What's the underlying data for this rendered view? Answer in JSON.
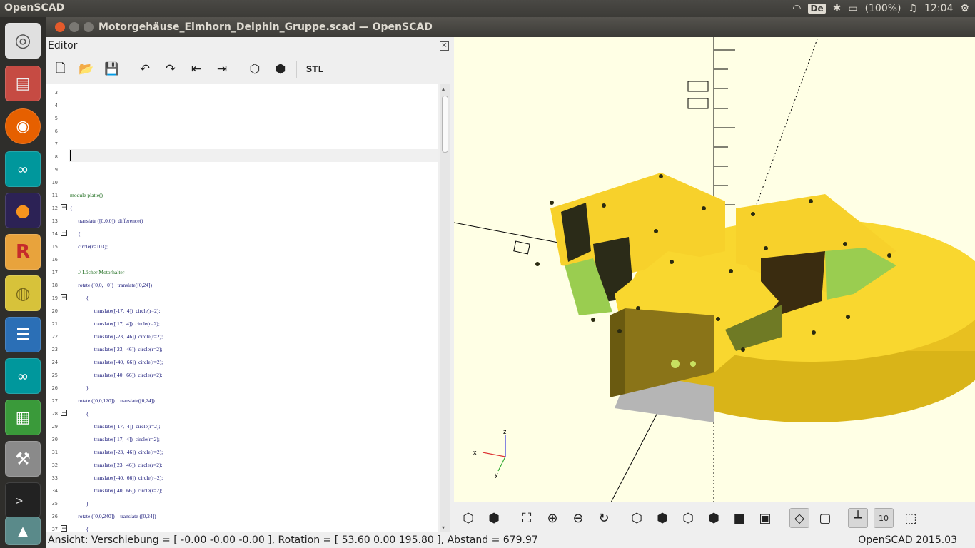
{
  "topbar": {
    "app_name": "OpenSCAD",
    "keyboard": "De",
    "battery": "(100%)",
    "clock": "12:04"
  },
  "window": {
    "title": "Motorgehäuse_Eimhorn_Delphin_Gruppe.scad — OpenSCAD"
  },
  "editor": {
    "title": "Editor",
    "toolbar": {
      "stl_label": "STL"
    },
    "lines": [
      {
        "n": "3",
        "t": ""
      },
      {
        "n": "4",
        "t": ""
      },
      {
        "n": "5",
        "t": ""
      },
      {
        "n": "6",
        "t": ""
      },
      {
        "n": "7",
        "t": ""
      },
      {
        "n": "8",
        "t": ""
      },
      {
        "n": "9",
        "t": ""
      },
      {
        "n": "10",
        "t": ""
      },
      {
        "n": "11",
        "t": "module platte()"
      },
      {
        "n": "12",
        "t": "{",
        "fold": "−"
      },
      {
        "n": "13",
        "t": "      translate ([0,0,0])  difference()"
      },
      {
        "n": "14",
        "t": "      {",
        "fold": "−"
      },
      {
        "n": "15",
        "t": "      circle(r=103);"
      },
      {
        "n": "16",
        "t": ""
      },
      {
        "n": "17",
        "t": "      // Löcher Motorhalter"
      },
      {
        "n": "18",
        "t": "      rotate ([0,0,   0])   translate([0,24])"
      },
      {
        "n": "19",
        "t": "            {",
        "fold": "−"
      },
      {
        "n": "20",
        "t": "                  translate([-17,  4])  circle(r=2);"
      },
      {
        "n": "21",
        "t": "                  translate([ 17,  4])  circle(r=2);"
      },
      {
        "n": "22",
        "t": "                  translate([-23,  46])  circle(r=2);"
      },
      {
        "n": "23",
        "t": "                  translate([ 23,  46])  circle(r=2);"
      },
      {
        "n": "24",
        "t": "                  translate([-40,  66])  circle(r=2);"
      },
      {
        "n": "25",
        "t": "                  translate([ 40,  66])  circle(r=2);"
      },
      {
        "n": "26",
        "t": "            }"
      },
      {
        "n": "27",
        "t": "      rotate ([0,0,120])    translate([0,24])"
      },
      {
        "n": "28",
        "t": "            {",
        "fold": "−"
      },
      {
        "n": "29",
        "t": "                  translate([-17,  4])  circle(r=2);"
      },
      {
        "n": "30",
        "t": "                  translate([ 17,  4])  circle(r=2);"
      },
      {
        "n": "31",
        "t": "                  translate([-23,  46])  circle(r=2);"
      },
      {
        "n": "32",
        "t": "                  translate([ 23,  46])  circle(r=2);"
      },
      {
        "n": "33",
        "t": "                  translate([-40,  66])  circle(r=2);"
      },
      {
        "n": "34",
        "t": "                  translate([ 40,  66])  circle(r=2);"
      },
      {
        "n": "35",
        "t": "            }"
      },
      {
        "n": "36",
        "t": "      rotate ([0,0,240])    translate ([0,24])"
      },
      {
        "n": "37",
        "t": "            {",
        "fold": "−"
      }
    ]
  },
  "viewport": {
    "axis_labels": {
      "x": "x",
      "y": "y",
      "z": "z"
    },
    "zoom_badge": "10"
  },
  "status": {
    "left": "Ansicht: Verschiebung = [ -0.00 -0.00 -0.00 ], Rotation = [ 53.60 0.00 195.80 ], Abstand = 679.97",
    "right": "OpenSCAD 2015.03"
  },
  "colors": {
    "model_top": "#f9d72f",
    "model_side": "#e8c020",
    "cutaway": "#9acd50",
    "viewport_bg": "#ffffe5"
  }
}
